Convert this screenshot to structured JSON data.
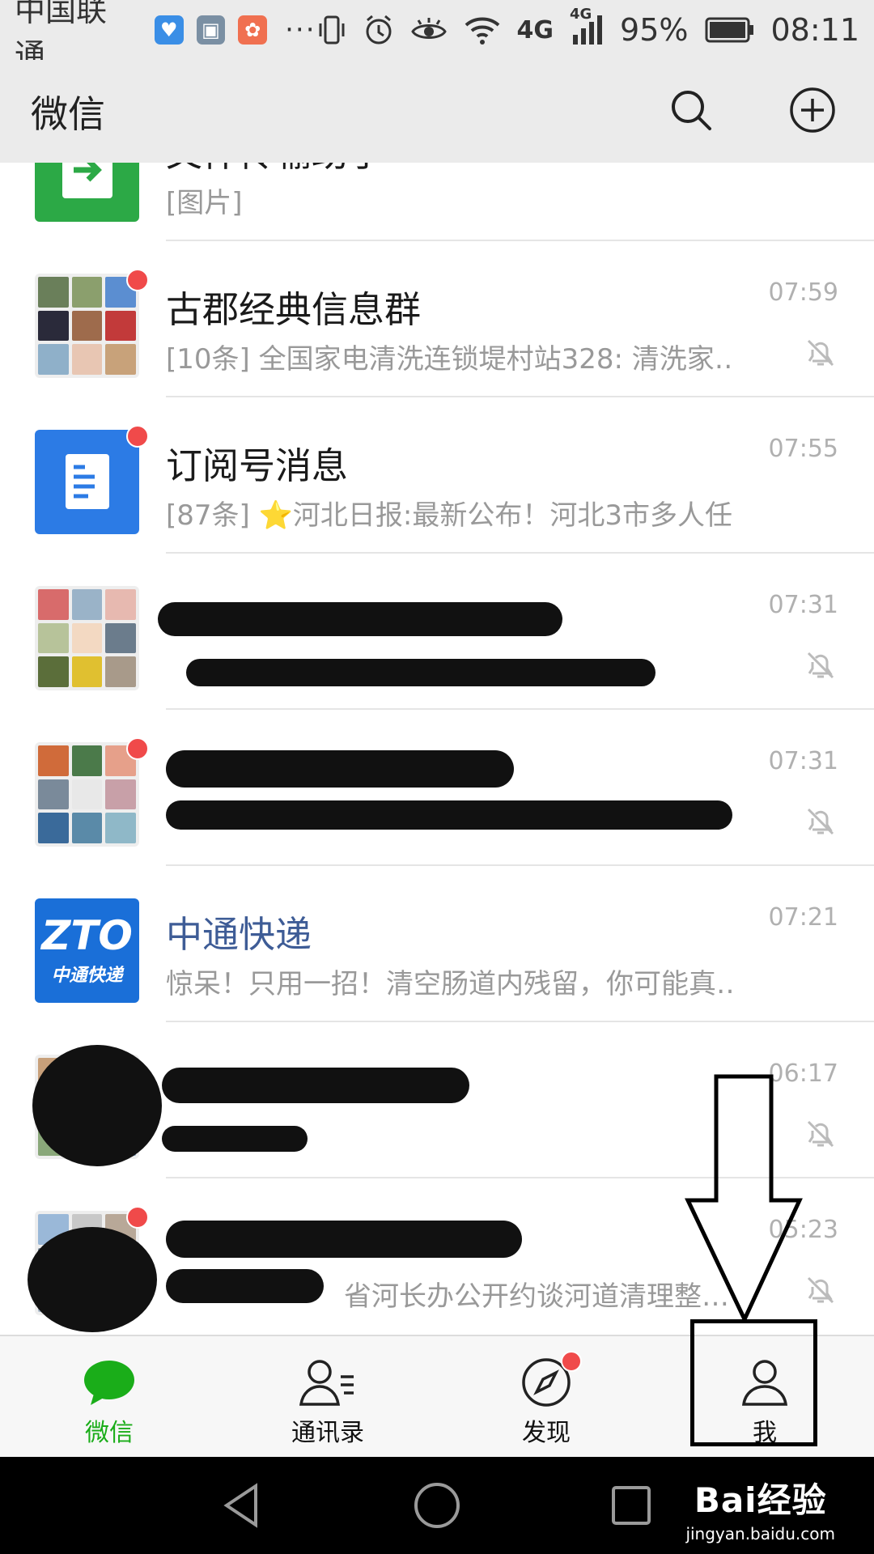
{
  "statusbar": {
    "carrier": "中国联通",
    "more": "···",
    "network1": "4G",
    "network2": "4G",
    "battery": "95%",
    "clock": "08:11"
  },
  "topbar": {
    "title": "微信",
    "search_icon": "search-icon",
    "add_icon": "plus-circle-icon"
  },
  "chats": [
    {
      "name": "文件传输助手",
      "preview": "[图片]",
      "time": "",
      "muted": false
    },
    {
      "name": "古郡经典信息群",
      "preview": "[10条] 全国家电清洗连锁堤村站328: 清洗家…",
      "time": "07:59",
      "muted": true
    },
    {
      "name": "订阅号消息",
      "preview": "[87条] ⭐河北日报:最新公布！河北3市多人任…",
      "time": "07:55",
      "muted": false
    },
    {
      "name": "",
      "preview": "",
      "time": "07:31",
      "muted": true
    },
    {
      "name": "",
      "preview": "",
      "time": "07:31",
      "muted": true
    },
    {
      "name": "中通快递",
      "preview": "惊呆！只用一招！清空肠道内残留，你可能真…",
      "time": "07:21",
      "muted": false
    },
    {
      "name": "",
      "preview": "",
      "time": "06:17",
      "muted": true
    },
    {
      "name": "",
      "preview": "省河长办公开约谈河道清理整…",
      "time": "05:23",
      "muted": true
    }
  ],
  "zto_logo": {
    "top": "ZTO",
    "bottom": "中通快递"
  },
  "tabs": [
    {
      "label": "微信",
      "icon": "chat-bubble-icon"
    },
    {
      "label": "通讯录",
      "icon": "contacts-icon"
    },
    {
      "label": "发现",
      "icon": "compass-icon"
    },
    {
      "label": "我",
      "icon": "person-icon"
    }
  ],
  "watermark": {
    "line1": "Bai经验",
    "line2": "jingyan.baidu.com"
  },
  "colors": {
    "accent": "#1aad19",
    "badge": "#f04a4a",
    "official": "#3e5c96",
    "file_helper": "#2ca946",
    "subscription": "#2c7be5",
    "zto": "#1a6fd8"
  }
}
